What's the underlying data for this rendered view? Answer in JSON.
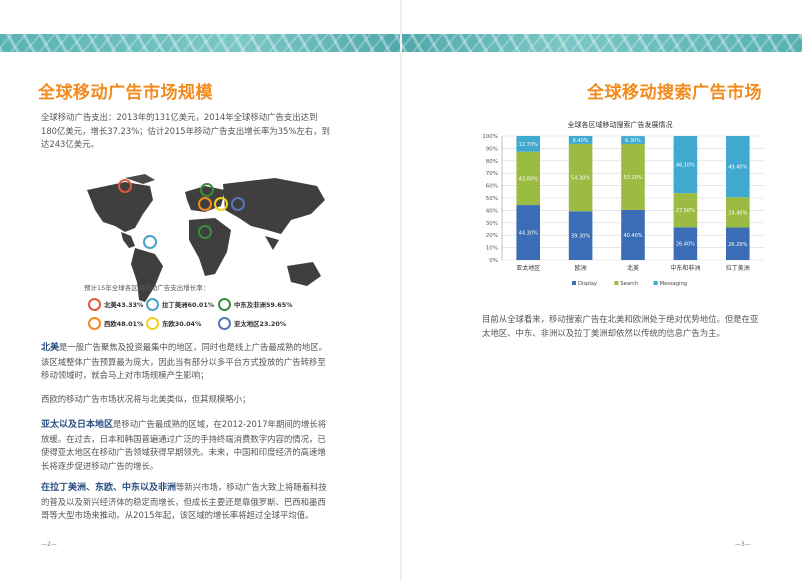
{
  "left_page": {
    "title": "全球移动广告市场规模",
    "intro": "全球移动广告支出：2013年的131亿美元，2014年全球移动广告支出达到180亿美元，增长37.23%；估计2015年移动广告支出增长率为35%左右，到达243亿美元。",
    "map_legend_title": "预计15年全球各区域移动广告支出增长率：",
    "map_legend": [
      {
        "label": "北美43.33%",
        "color": "#e2583e"
      },
      {
        "label": "拉丁美洲60.01%",
        "color": "#4aa3c8"
      },
      {
        "label": "中东及非洲59.65%",
        "color": "#3c8d3a"
      },
      {
        "label": "西欧48.01%",
        "color": "#f28a1e"
      },
      {
        "label": "东欧30.04%",
        "color": "#f2d21e"
      },
      {
        "label": "亚太地区23.20%",
        "color": "#5577b8"
      }
    ],
    "para_na_head": "北美",
    "para_na": "是一般广告聚焦及投资最集中的地区，同时也是线上广告最成熟的地区。该区域整体广告预算最为庞大，因此当有部分以多平台方式投放的广告转移至移动领域时，就会马上对市场规模产生影响；",
    "para_we": "西欧的移动广告市场状况将与北美类似，但其规模略小；",
    "para_ap_head": "亚太以及日本地区",
    "para_ap": "是移动广告最成熟的区域，在2012-2017年期间的增长将放缓。在过去，日本和韩国普遍通过广泛的手持终端消费数字内容的情况，已使得亚太地区在移动广告领域获得早期领先。未来，中国和印度经济的高速增长将逐步促进移动广告的增长。",
    "para_la_head": "在拉丁美洲、东欧、中东以及非洲",
    "para_la": "等新兴市场，移动广告大致上将随着科技的普及以及新兴经济体的稳定而增长，但成长主要还是靠俄罗斯、巴西和墨西哥等大型市场来推动。从2015年起，该区域的增长率将超过全球平均值。",
    "page_number": "—2—"
  },
  "right_page": {
    "title": "全球移动搜索广告市场",
    "body": "目前从全球看来，移动搜索广告在北美和欧洲处于绝对优势地位。但是在亚太地区、中东、非洲以及拉丁美洲却依然以传统的信息广告为主。",
    "page_number": "—3—"
  },
  "chart_data": {
    "type": "bar",
    "stacked": true,
    "title": "全球各区域移动搜索广告发展情况",
    "categories": [
      "亚太地区",
      "欧洲",
      "北美",
      "中东和非洲",
      "拉丁美洲"
    ],
    "series": [
      {
        "name": "Display",
        "color": "#3a6db5",
        "values": [
          44.3,
          39.3,
          40.4,
          26.4,
          26.2
        ],
        "labels": [
          "44.30%",
          "39.30%",
          "40.40%",
          "26.40%",
          "26.20%"
        ]
      },
      {
        "name": "Search",
        "color": "#9bbb43",
        "values": [
          43.0,
          54.3,
          53.2,
          27.5,
          24.4
        ],
        "labels": [
          "43.00%",
          "54.30%",
          "53.20%",
          "27.50%",
          "24.40%"
        ]
      },
      {
        "name": "Messaging",
        "color": "#3fa9cf",
        "values": [
          12.7,
          6.4,
          6.3,
          46.1,
          49.4
        ],
        "labels": [
          "12.70%",
          "6.40%",
          "6.30%",
          "46.10%",
          "49.40%"
        ]
      }
    ],
    "y_ticks": [
      "0%",
      "10%",
      "20%",
      "30%",
      "40%",
      "50%",
      "60%",
      "70%",
      "80%",
      "90%",
      "100%"
    ],
    "ylim": [
      0,
      100
    ],
    "grid": true,
    "legend_position": "bottom"
  }
}
